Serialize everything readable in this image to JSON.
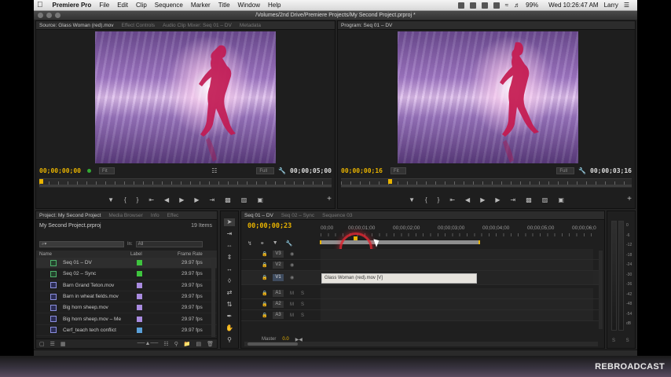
{
  "menubar": {
    "app_name": "Premiere Pro",
    "items": [
      "File",
      "Edit",
      "Clip",
      "Sequence",
      "Marker",
      "Title",
      "Window",
      "Help"
    ],
    "battery": "99%",
    "clock": "Wed 10:26:47 AM",
    "user": "Larry"
  },
  "window": {
    "title": "/Volumes/2nd Drive/Premiere Projects/My Second Project.prproj *"
  },
  "source_monitor": {
    "tabs": [
      "Source: Glass Woman (red).mov",
      "Effect Controls",
      "Audio Clip Mixer: Seq 01 – DV",
      "Metadata"
    ],
    "timecode_in": "00;00;00;00",
    "fit": "Fit",
    "resolution": "Full",
    "duration": "00;00;05;00"
  },
  "program_monitor": {
    "tabs": [
      "Program: Seq 01 – DV"
    ],
    "timecode_in": "00;00;00;16",
    "fit": "Fit",
    "resolution": "Full",
    "duration": "00;00;03;16"
  },
  "project_panel": {
    "tabs": [
      "Project: My Second Project",
      "Media Browser",
      "Info",
      "Effec"
    ],
    "project_file": "My Second Project.prproj",
    "item_count": "19 Items",
    "search_placeholder": "⌕▾",
    "in_label": "In:",
    "in_value": "All",
    "columns": [
      "Name",
      "Label",
      "Frame Rate"
    ],
    "items": [
      {
        "name": "Seq 01 – DV",
        "type": "sequence",
        "label_color": "#3ec43e",
        "frame_rate": "29.97 fps"
      },
      {
        "name": "Seq 02 – Sync",
        "type": "sequence",
        "label_color": "#3ec43e",
        "frame_rate": "29.97 fps"
      },
      {
        "name": "Barn Grand Teton.mov",
        "type": "clip",
        "label_color": "#a98be0",
        "frame_rate": "29.97 fps"
      },
      {
        "name": "Barn in wheat fields.mov",
        "type": "clip",
        "label_color": "#a98be0",
        "frame_rate": "29.97 fps"
      },
      {
        "name": "Big horn sheep.mov",
        "type": "clip",
        "label_color": "#a98be0",
        "frame_rate": "29.97 fps"
      },
      {
        "name": "Big horn sheep.mov – Me",
        "type": "clip",
        "label_color": "#a98be0",
        "frame_rate": "29.97 fps"
      },
      {
        "name": "Cerf_teach tech conflict",
        "type": "clip",
        "label_color": "#5aa0d8",
        "frame_rate": "29.97 fps"
      }
    ]
  },
  "timeline": {
    "tabs": [
      "Seq 01 – DV",
      "Seq 02 – Sync",
      "Sequence 03"
    ],
    "timecode": "00;00;00;23",
    "ruler_labels": [
      "00;00",
      "00;00;01;00",
      "00;00;02;00",
      "00;00;03;00",
      "00;00;04;00",
      "00;00;05;00",
      "00;00;06;0"
    ],
    "video_tracks": [
      "V3",
      "V2",
      "V1"
    ],
    "audio_tracks": [
      "A1",
      "A2",
      "A3"
    ],
    "clip_name": "Glass Woman (red).mov [V]",
    "master_label": "Master",
    "master_db": "0.0"
  },
  "meters": {
    "db_labels": [
      "0",
      "-6",
      "-12",
      "-18",
      "-24",
      "-30",
      "-36",
      "-42",
      "-48",
      "-54",
      "dB"
    ]
  },
  "watermark": "REBROADCAST"
}
